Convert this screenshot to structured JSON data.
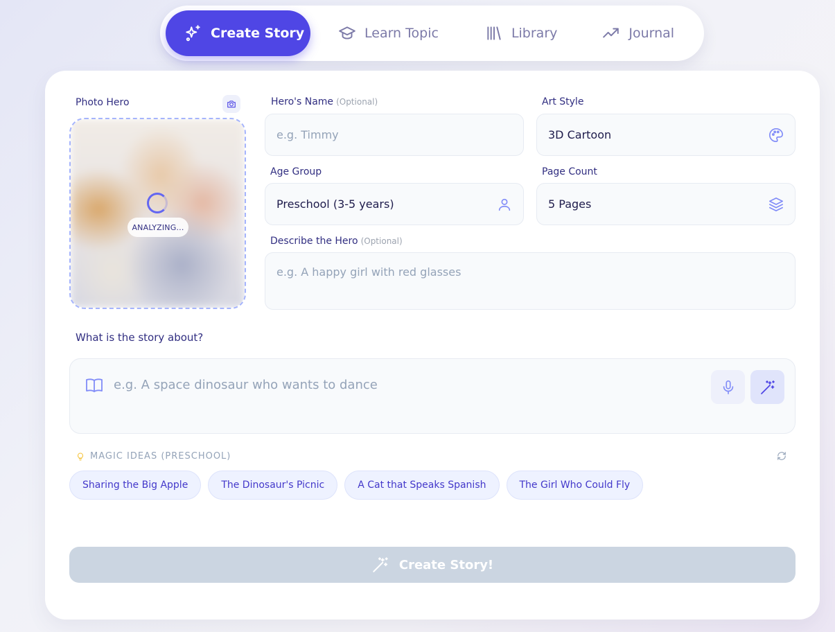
{
  "nav": {
    "tabs": [
      {
        "label": "Create Story",
        "icon": "sparkles-icon",
        "active": true
      },
      {
        "label": "Learn Topic",
        "icon": "graduation-cap-icon",
        "active": false
      },
      {
        "label": "Library",
        "icon": "library-icon",
        "active": false
      },
      {
        "label": "Journal",
        "icon": "trending-up-icon",
        "active": false
      }
    ]
  },
  "form": {
    "photo_hero_label": "Photo Hero",
    "photo_status": "ANALYZING...",
    "hero_name": {
      "label": "Hero's Name",
      "optional": "(Optional)",
      "placeholder": "e.g. Timmy",
      "value": ""
    },
    "art_style": {
      "label": "Art Style",
      "value": "3D Cartoon",
      "icon": "palette-icon"
    },
    "age_group": {
      "label": "Age Group",
      "value": "Preschool (3-5 years)",
      "icon": "user-icon"
    },
    "page_count": {
      "label": "Page Count",
      "value": "5 Pages",
      "icon": "layers-icon"
    },
    "describe_hero": {
      "label": "Describe the Hero",
      "optional": "(Optional)",
      "placeholder": "e.g. A happy girl with red glasses"
    },
    "story_about": {
      "label": "What is the story about?",
      "placeholder": "e.g. A space dinosaur who wants to dance"
    }
  },
  "ideas": {
    "title": "MAGIC IDEAS (PRESCHOOL)",
    "items": [
      "Sharing the Big Apple",
      "The Dinosaur's Picnic",
      "A Cat that Speaks Spanish",
      "The Girl Who Could Fly"
    ]
  },
  "create_button": "Create Story!",
  "colors": {
    "accent": "#4f46e5",
    "text": "#312e81",
    "field_bg": "#f8fafc",
    "chip_bg": "#eef2ff",
    "disabled_button": "#cbd5e1"
  }
}
